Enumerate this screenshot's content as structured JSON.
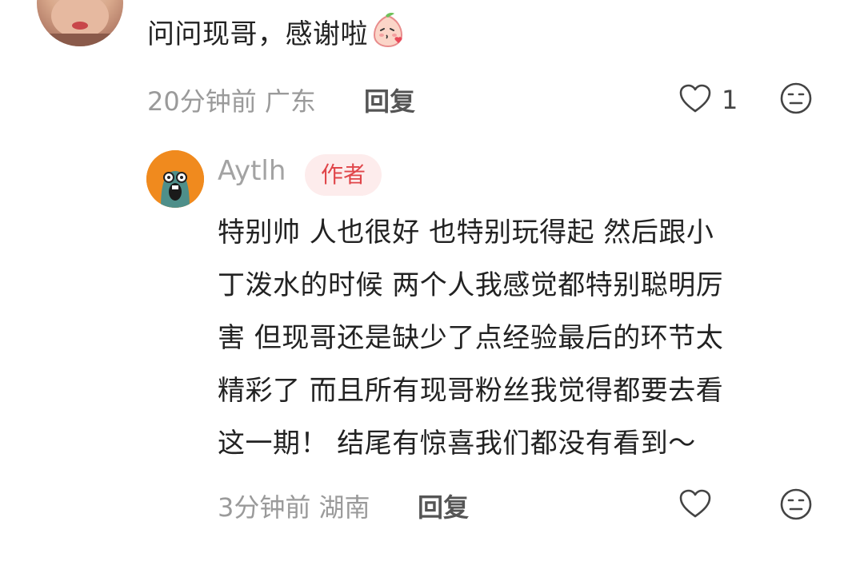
{
  "top_comment": {
    "text": "问问现哥，感谢啦",
    "emoji": "peach-blowing-kiss-emoji",
    "time": "20分钟前",
    "location": "广东",
    "reply_label": "回复",
    "likes": "1"
  },
  "reply": {
    "username": "Aytlh",
    "badge": "作者",
    "lines": [
      "特别帅 人也很好 也特别玩得起 然后跟小",
      "丁泼水的时候 两个人我感觉都特别聪明厉",
      "害 但现哥还是缺少了点经验最后的环节太",
      "精彩了 而且所有现哥粉丝我觉得都要去看",
      "这一期！ 结尾有惊喜我们都没有看到～"
    ],
    "time": "3分钟前",
    "location": "湖南",
    "reply_label": "回复"
  },
  "colors": {
    "badge_text": "#e0464a",
    "badge_bg": "#fdecec",
    "meta": "#9a9a9a",
    "icon": "#444444"
  }
}
